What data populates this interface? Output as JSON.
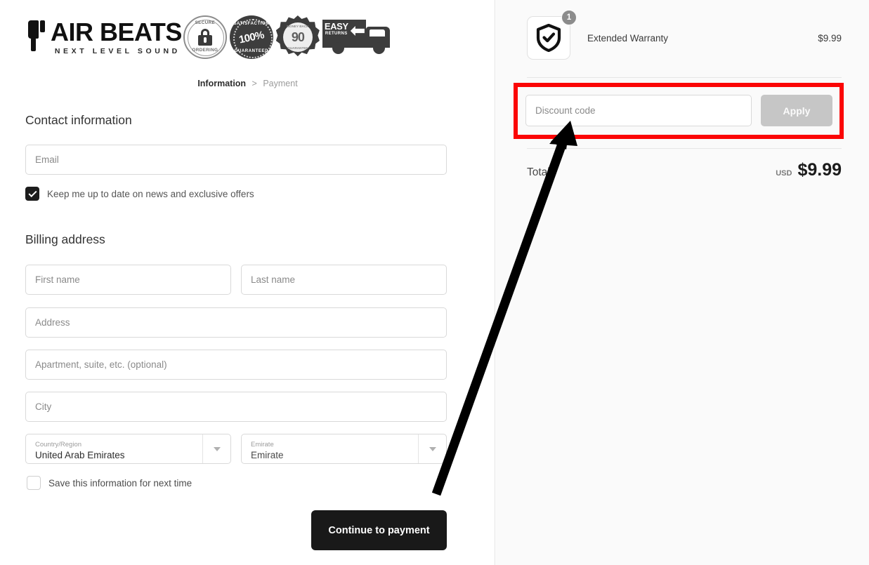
{
  "brand": {
    "name": "AIR BEATS",
    "tagline": "NEXT LEVEL SOUND",
    "badges": [
      {
        "id": "secure-ordering",
        "top": "SECURE",
        "bottom": "ORDERING"
      },
      {
        "id": "satisfaction-guaranteed",
        "top": "SATISFACTION",
        "center": "100%",
        "bottom": "GUARANTEED"
      },
      {
        "id": "money-back-guarantee",
        "top": "MONEY BACK",
        "center": "90",
        "bottom": "GUARANTEE"
      },
      {
        "id": "easy-returns",
        "line1": "EASY",
        "line2": "RETURNS"
      }
    ]
  },
  "breadcrumb": {
    "active": "Information",
    "separator": ">",
    "inactive": "Payment"
  },
  "contact": {
    "title": "Contact information",
    "email_placeholder": "Email",
    "newsletter_label": "Keep me up to date on news and exclusive offers",
    "newsletter_checked": true
  },
  "billing": {
    "title": "Billing address",
    "first_name_placeholder": "First name",
    "last_name_placeholder": "Last name",
    "address_placeholder": "Address",
    "apartment_placeholder": "Apartment, suite, etc. (optional)",
    "city_placeholder": "City",
    "country": {
      "label": "Country/Region",
      "value": "United Arab Emirates"
    },
    "emirate": {
      "label": "Emirate",
      "value": "Emirate"
    },
    "save_label": "Save this information for next time",
    "save_checked": false
  },
  "actions": {
    "continue_label": "Continue to payment"
  },
  "order_summary": {
    "item": {
      "name": "Extended Warranty",
      "price": "$9.99",
      "quantity": "1",
      "icon": "shield-check-icon"
    },
    "discount": {
      "placeholder": "Discount code",
      "value": "",
      "apply_label": "Apply"
    },
    "total": {
      "label": "Total",
      "currency": "USD",
      "amount": "$9.99"
    }
  },
  "annotation": {
    "highlight_color": "#fb0505",
    "arrow_color": "#000000",
    "target": "discount-code-field"
  }
}
